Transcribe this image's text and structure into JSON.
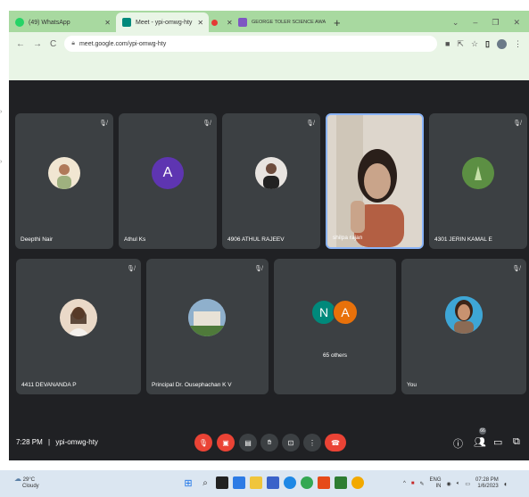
{
  "browser": {
    "tabs": [
      {
        "label": "(49) WhatsApp",
        "favicon_color": "#25d366",
        "active": false
      },
      {
        "label": "Meet - ypi-omwg-hty",
        "favicon_color": "#00897b",
        "active": true
      },
      {
        "label": "",
        "favicon_color": "#e53935",
        "active": false
      },
      {
        "label": "GEORGE TOLER SCIENCE AWA",
        "favicon_color": "#7e57c2",
        "active": false
      }
    ],
    "tab_close": "✕",
    "new_tab": "+",
    "url": "meet.google.com/ypi-omwg-hty",
    "window_controls": [
      "⌄",
      "–",
      "❐",
      "✕"
    ]
  },
  "meeting": {
    "participants": [
      {
        "name": "Deepthi Nair",
        "muted": true,
        "avatar_type": "photo",
        "avatar_color": "#f1e6d2"
      },
      {
        "name": "Athul Ks",
        "muted": true,
        "avatar_type": "initial",
        "initial": "A",
        "avatar_color": "#5e35b1"
      },
      {
        "name": "4906 ATHUL RAJEEV",
        "muted": true,
        "avatar_type": "photo",
        "avatar_color": "#e8e4e0"
      },
      {
        "name": "shilpa rajan",
        "muted": false,
        "speaking": true,
        "avatar_type": "video",
        "avatar_color": "#c9a48a"
      },
      {
        "name": "4301 JERIN KAMAL E",
        "muted": true,
        "avatar_type": "photo",
        "avatar_color": "#4e7d3a"
      },
      {
        "name": "4411 DEVANANDA P",
        "muted": true,
        "avatar_type": "photo",
        "avatar_color": "#ead9c8"
      },
      {
        "name": "Principal Dr. Ousephachan K V",
        "muted": true,
        "avatar_type": "photo",
        "avatar_color": "#6f8aa6"
      },
      {
        "name": "65 others",
        "muted": false,
        "avatar_type": "others",
        "initials": [
          "N",
          "A"
        ],
        "avatar_colors": [
          "#00897b",
          "#e8710a"
        ]
      },
      {
        "name": "You",
        "muted": true,
        "avatar_type": "photo",
        "avatar_color": "#3ea6d6"
      }
    ],
    "clock": "7:28 PM",
    "separator": "|",
    "meeting_code": "ypi-omwg-hty",
    "participant_count": "66",
    "controls": {
      "mic": "mic-off",
      "camera": "camera-off",
      "captions": "captions",
      "raise_hand": "raise-hand",
      "present": "present",
      "more": "more",
      "end_call": "end-call"
    }
  },
  "taskbar": {
    "weather_temp": "29°C",
    "weather_desc": "Cloudy",
    "lang_top": "ENG",
    "lang_bottom": "IN",
    "time": "07:28 PM",
    "date": "1/6/2023"
  }
}
